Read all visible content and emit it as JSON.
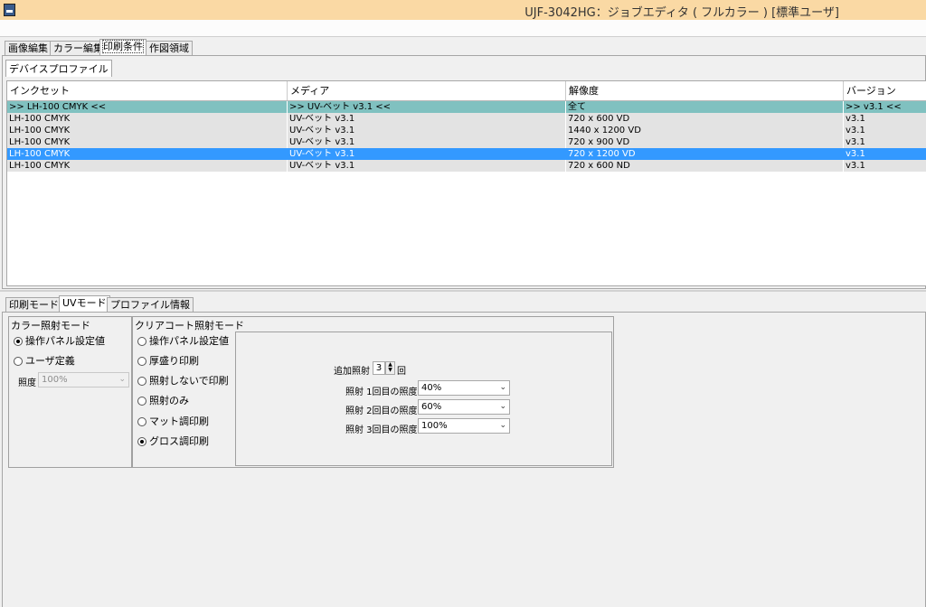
{
  "window": {
    "title": "UJF-3042HG：ジョブエディタ ( フルカラー ) [標準ユーザ]"
  },
  "main_tabs": [
    "画像編集",
    "カラー編集",
    "印刷条件",
    "作図領域"
  ],
  "sub_tab": "デバイスプロファイル",
  "table": {
    "columns": [
      "インクセット",
      "メディア",
      "解像度",
      "バージョン"
    ],
    "filter_row": [
      ">> LH-100 CMYK <<",
      ">> UV-ベット v3.1 <<",
      "全て",
      ">> v3.1 <<"
    ],
    "rows": [
      [
        "LH-100 CMYK",
        "UV-ベット v3.1",
        "720 x 600 VD",
        "v3.1"
      ],
      [
        "LH-100 CMYK",
        "UV-ベット v3.1",
        "1440 x 1200 VD",
        "v3.1"
      ],
      [
        "LH-100 CMYK",
        "UV-ベット v3.1",
        "720 x 900 VD",
        "v3.1"
      ],
      [
        "LH-100 CMYK",
        "UV-ベット v3.1",
        "720 x 1200 VD",
        "v3.1"
      ],
      [
        "LH-100 CMYK",
        "UV-ベット v3.1",
        "720 x 600 ND",
        "v3.1"
      ]
    ],
    "selected_row": 4
  },
  "lower_tabs": [
    "印刷モード",
    "UVモード",
    "プロファイル情報"
  ],
  "color_irradiation": {
    "title": "カラー照射モード",
    "options": [
      "操作パネル設定値",
      "ユーザ定義"
    ],
    "selected": 0,
    "illuminance_label": "照度",
    "illuminance_value": "100%"
  },
  "clearcoat_irradiation": {
    "title": "クリアコート照射モード",
    "options": [
      "操作パネル設定値",
      "厚盛り印刷",
      "照射しないで印刷",
      "照射のみ",
      "マット調印刷",
      "グロス調印刷"
    ],
    "selected": 5,
    "additional_label": "追加照射",
    "additional_value": "3",
    "additional_unit": "回",
    "levels": [
      {
        "label": "照射 1回目の照度",
        "value": "40%"
      },
      {
        "label": "照射 2回目の照度",
        "value": "60%"
      },
      {
        "label": "照射 3回目の照度",
        "value": "100%"
      }
    ]
  }
}
